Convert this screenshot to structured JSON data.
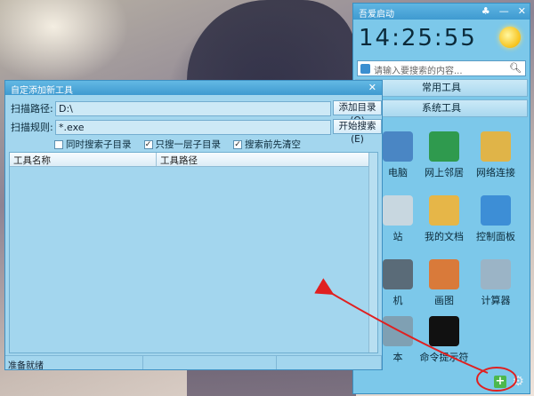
{
  "launcher": {
    "title": "吾爱启动",
    "clock": "14:25:55",
    "search_placeholder": "请输入要搜索的内容...",
    "categories": [
      "常用工具",
      "系统工具"
    ],
    "icons": [
      {
        "label": "电脑",
        "color": "#4a86c4"
      },
      {
        "label": "网上邻居",
        "color": "#2f9a4e"
      },
      {
        "label": "网络连接",
        "color": "#e0b448"
      },
      {
        "label": "站",
        "color": "#c8d7e0"
      },
      {
        "label": "我的文档",
        "color": "#e6b648"
      },
      {
        "label": "控制面板",
        "color": "#3d8ed6"
      },
      {
        "label": "机",
        "color": "#5a6b78"
      },
      {
        "label": "画图",
        "color": "#d97a3a"
      },
      {
        "label": "计算器",
        "color": "#9bb4c6"
      },
      {
        "label": "本",
        "color": "#7fa0b3"
      },
      {
        "label": "命令提示符",
        "color": "#111111"
      }
    ]
  },
  "dialog": {
    "title": "自定添加新工具",
    "scan_path_label": "扫描路径:",
    "scan_path_value": "D:\\",
    "scan_rule_label": "扫描规则:",
    "scan_rule_value": "*.exe",
    "add_dir_button": "添加目录(O)",
    "start_search_button": "开始搜索(E)",
    "options": [
      {
        "label": "同时搜索子目录",
        "checked": false
      },
      {
        "label": "只搜一层子目录",
        "checked": true
      },
      {
        "label": "搜索前先清空",
        "checked": true
      }
    ],
    "columns": [
      "工具名称",
      "工具路径"
    ],
    "status": "准备就绪"
  },
  "colors": {
    "accent": "#3f9ad0",
    "panel": "#7cc8ea",
    "arrow": "#e02020"
  }
}
